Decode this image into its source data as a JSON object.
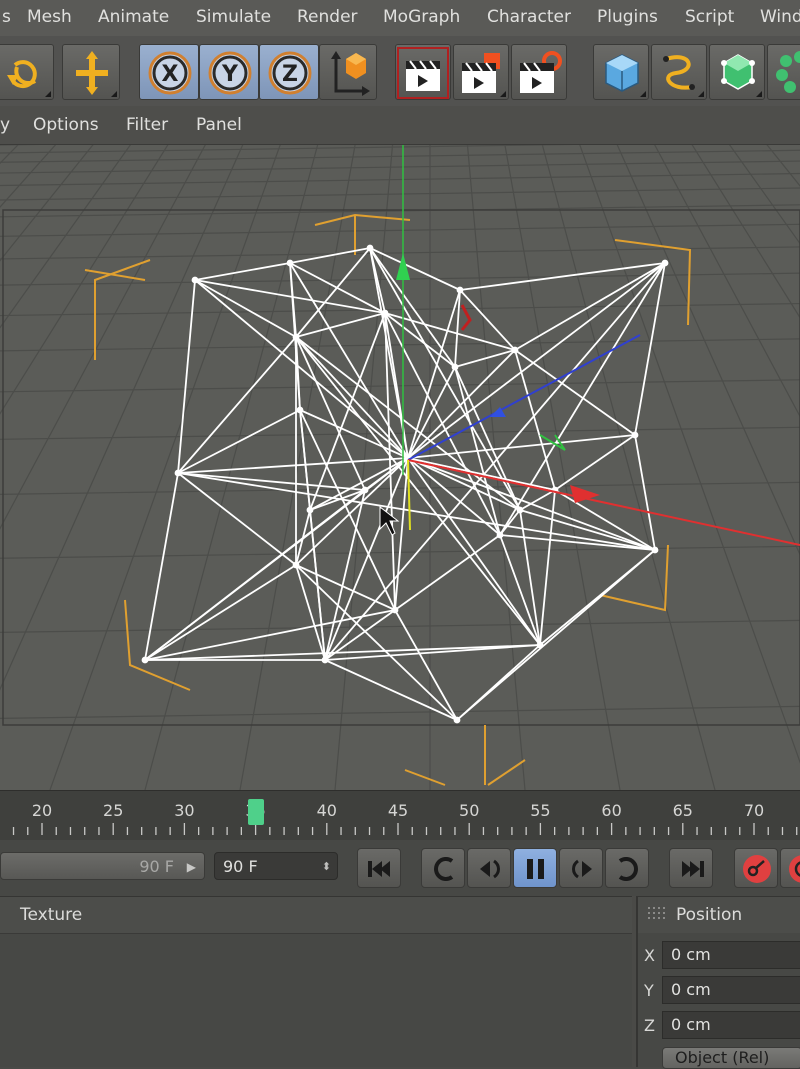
{
  "menubar": {
    "items": [
      "s",
      "Mesh",
      "Animate",
      "Simulate",
      "Render",
      "MoGraph",
      "Character",
      "Plugins",
      "Script",
      "Wind"
    ]
  },
  "toolbar": {
    "axis_x": "X",
    "axis_y": "Y",
    "axis_z": "Z",
    "icons": [
      "rotate-icon",
      "move-icon",
      "axis-x-lock-icon",
      "axis-y-lock-icon",
      "axis-z-lock-icon",
      "world-coordinates-icon",
      "render-view-icon",
      "render-picture-viewer-icon",
      "render-settings-icon",
      "cube-icon",
      "spline-icon",
      "nurbs-icon",
      "mograph-icon"
    ]
  },
  "viewport_menu": {
    "items": [
      "y",
      "Options",
      "Filter",
      "Panel"
    ]
  },
  "timeline": {
    "ticks": [
      "20",
      "25",
      "30",
      "35",
      "40",
      "45",
      "50",
      "55",
      "60",
      "65",
      "70"
    ],
    "current_frame": 35
  },
  "transport": {
    "end_frame_slider": "90 F",
    "end_frame_field": "90 F",
    "buttons": [
      "go-to-start",
      "play-backwards",
      "step-back",
      "pause",
      "step-forward",
      "loop",
      "go-to-end",
      "record-keys",
      "autokey"
    ]
  },
  "attributes": {
    "tab_label": "Texture"
  },
  "coordinates": {
    "header": "Position",
    "x_label": "X",
    "x_value": "0 cm",
    "y_label": "Y",
    "y_value": "0 cm",
    "z_label": "Z",
    "z_value": "0 cm",
    "mode_select": "Object (Rel)"
  },
  "colors": {
    "accent_blue": "#7e95b8",
    "playhead_green": "#4fd08a",
    "selection_orange": "#e0a030",
    "axis_x": "#e03030",
    "axis_y": "#30c040",
    "axis_z": "#3040d0"
  }
}
